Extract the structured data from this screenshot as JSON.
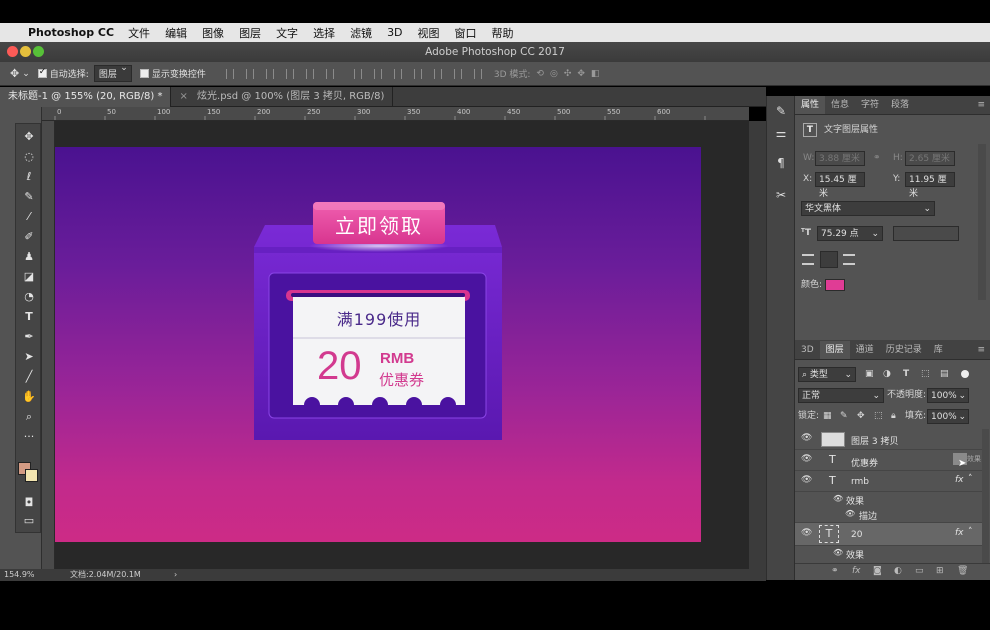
{
  "menubar": {
    "app_name": "Photoshop CC",
    "items": [
      "文件",
      "编辑",
      "图像",
      "图层",
      "文字",
      "选择",
      "滤镜",
      "3D",
      "视图",
      "窗口",
      "帮助"
    ]
  },
  "window": {
    "title": "Adobe Photoshop CC 2017"
  },
  "options": {
    "auto_select_label": "自动选择:",
    "auto_select_value": "图层",
    "show_transform_label": "显示变换控件",
    "mode_3d_label": "3D 模式:"
  },
  "doc_tabs": [
    {
      "label": "未标题-1 @ 155% (20, RGB/8) *",
      "active": true
    },
    {
      "label": "炫光.psd @ 100% (图层 3 拷贝, RGB/8)",
      "active": false
    }
  ],
  "ruler_ticks": [
    "0",
    "50",
    "100",
    "150",
    "200",
    "250",
    "300",
    "350",
    "400",
    "450",
    "500",
    "550",
    "600"
  ],
  "canvas": {
    "header_button": "立即领取",
    "coupon_condition": "满199使用",
    "coupon_amount": "20",
    "coupon_currency": "RMB",
    "coupon_name": "优惠券",
    "colors": {
      "bg_top": "#4a1290",
      "bg_bottom": "#cd2b86",
      "accent": "#e03c95",
      "amount": "#d23a8f",
      "card": "#f4f4f6",
      "box": "#6b22c6"
    }
  },
  "status": {
    "zoom": "154.9%",
    "doc_info": "文档:2.04M/20.1M"
  },
  "properties": {
    "tabs": [
      "属性",
      "信息",
      "字符",
      "段落"
    ],
    "header": "文字图层属性",
    "w_label": "W:",
    "w_value": "3.88 厘米",
    "h_label": "H:",
    "h_value": "2.65 厘米",
    "x_label": "X:",
    "x_value": "15.45 厘米",
    "y_label": "Y:",
    "y_value": "11.95 厘米",
    "font": "华文黑体",
    "size": "75.29 点",
    "color_label": "颜色:",
    "color": "#e03c95"
  },
  "layers_panel": {
    "tabs": [
      "3D",
      "图层",
      "通道",
      "历史记录",
      "库"
    ],
    "filter_label": "类型",
    "blend_mode": "正常",
    "opacity_label": "不透明度:",
    "opacity_value": "100%",
    "lock_label": "锁定:",
    "fill_label": "填充:",
    "fill_value": "100%",
    "layers": [
      {
        "name": "图层 3 拷贝",
        "type": "image"
      },
      {
        "name": "优惠券",
        "type": "text",
        "effects_tag": "效果"
      },
      {
        "name": "rmb",
        "type": "text",
        "fx": "fx"
      },
      {
        "name": "效果",
        "type": "effect"
      },
      {
        "name": "描边",
        "type": "effect-item"
      },
      {
        "name": "20",
        "type": "text",
        "fx": "fx",
        "selected": true
      },
      {
        "name": "效果",
        "type": "effect"
      }
    ]
  }
}
